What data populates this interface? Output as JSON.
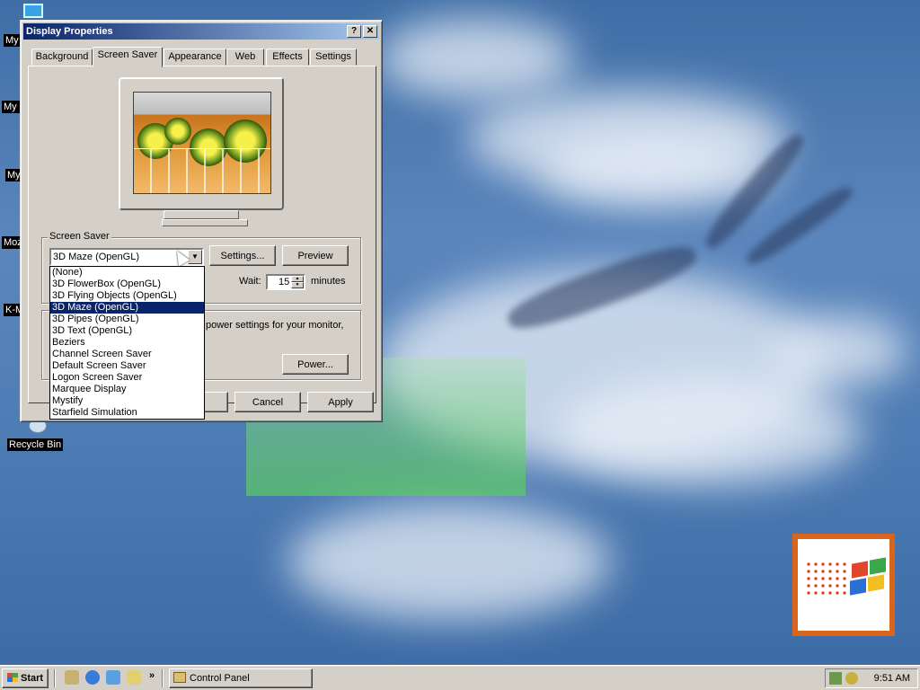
{
  "desktop": {
    "icons": [
      {
        "label": "My"
      },
      {
        "label": "My D"
      },
      {
        "label": "My"
      },
      {
        "label": "Moz"
      },
      {
        "label": "K-M"
      },
      {
        "label": "Recycle Bin"
      }
    ]
  },
  "dialog": {
    "title": "Display Properties",
    "help_btn": "?",
    "close_btn": "✕",
    "tabs": [
      {
        "label": "Background"
      },
      {
        "label": "Screen Saver"
      },
      {
        "label": "Appearance"
      },
      {
        "label": "Web"
      },
      {
        "label": "Effects"
      },
      {
        "label": "Settings"
      }
    ],
    "active_tab": "Screen Saver",
    "screen_saver_group": {
      "label": "Screen Saver",
      "selected": "3D Maze (OpenGL)",
      "settings_btn": "Settings...",
      "preview_btn": "Preview",
      "wait_label": "Wait:",
      "wait_value": "15",
      "minutes_label": "minutes",
      "options": [
        "(None)",
        "3D FlowerBox (OpenGL)",
        "3D Flying Objects (OpenGL)",
        "3D Maze (OpenGL)",
        "3D Pipes (OpenGL)",
        "3D Text (OpenGL)",
        "Beziers",
        "Channel Screen Saver",
        "Default Screen Saver",
        "Logon Screen Saver",
        "Marquee Display",
        "Mystify",
        "Starfield Simulation"
      ]
    },
    "energy_group": {
      "text": "power settings for your monitor,",
      "power_btn": "Power..."
    },
    "cancel_btn": "Cancel",
    "apply_btn": "Apply"
  },
  "taskbar": {
    "start_label": "Start",
    "task_label": "Control Panel",
    "clock": "9:51 AM",
    "quicklaunch_chevron": "»"
  },
  "colors": {
    "title_bar": "#0a246a",
    "selection": "#0a246a",
    "face": "#d4d0c8"
  }
}
